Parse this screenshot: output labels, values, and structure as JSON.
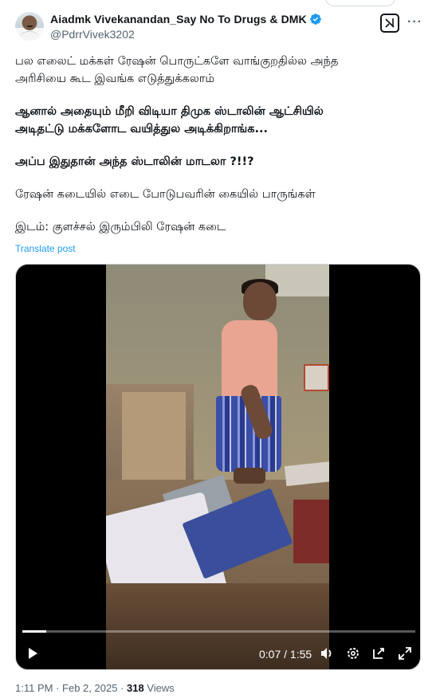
{
  "author": {
    "display_name": "Aiadmk Vivekanandan_Say No To Drugs & DMK",
    "handle": "@PdrrVivek3202",
    "verified": true
  },
  "tweet": {
    "paragraphs": [
      {
        "text": "பல எலைட் மக்கள் ரேஷன் பொருட்களே வாங்குறதில்ல அந்த",
        "bold": false
      },
      {
        "text": "அரிசியை கூட இவங்க எடுத்துக்கலாம்",
        "bold": false
      },
      {
        "text": "ஆனால் அதையும் மீறி விடியா திமுக ஸ்டாலின் ஆட்சியில்",
        "bold": true
      },
      {
        "text": "அடிதட்டு மக்களோட வயித்துல அடிக்கிறாங்க...",
        "bold": true
      },
      {
        "text": "அப்ப இதுதான் அந்த ஸ்டாலின் மாடலா ?!!?",
        "bold": true
      },
      {
        "text": "ரேஷன் கடையில் எடை போடுபவரின் கையில் பாருங்கள்",
        "bold": false
      },
      {
        "text": "இடம்: குளச்சல் இரும்பிலி ரேஷன் கடை",
        "bold": false
      }
    ],
    "translate_label": "Translate post"
  },
  "video": {
    "current_time": "0:07",
    "duration": "1:55",
    "time_display": "0:07 / 1:55",
    "progress_fraction": 0.06
  },
  "meta": {
    "time": "1:11 PM",
    "date": "Feb 2, 2025",
    "separator": "·",
    "views_count": "318",
    "views_label": "Views"
  },
  "colors": {
    "accent": "#1d9bf0",
    "text_primary": "#0f1419",
    "text_secondary": "#536471",
    "border": "#cfd9de"
  },
  "icons": {
    "verified": "verified-badge-icon",
    "grok": "grok-icon",
    "more": "more-icon",
    "play": "play-icon",
    "volume": "volume-icon",
    "settings": "settings-gear-icon",
    "pip": "picture-in-picture-icon",
    "fullscreen": "fullscreen-icon"
  }
}
